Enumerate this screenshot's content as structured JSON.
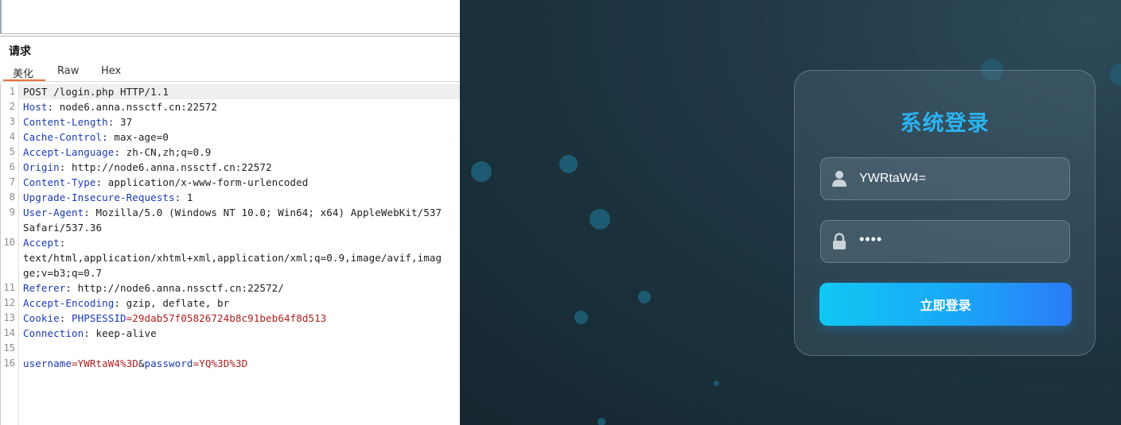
{
  "request_panel": {
    "title": "请求",
    "tabs": [
      {
        "label": "美化",
        "active": true
      },
      {
        "label": "Raw",
        "active": false
      },
      {
        "label": "Hex",
        "active": false
      }
    ],
    "lines": {
      "l1": {
        "n": "1",
        "text": "POST /login.php HTTP/1.1"
      },
      "l2": {
        "n": "2",
        "k": "Host",
        "v": ": node6.anna.nssctf.cn:22572"
      },
      "l3": {
        "n": "3",
        "k": "Content-Length",
        "v": ": 37"
      },
      "l4": {
        "n": "4",
        "k": "Cache-Control",
        "v": ": max-age=0"
      },
      "l5": {
        "n": "5",
        "k": "Accept-Language",
        "v": ": zh-CN,zh;q=0.9"
      },
      "l6": {
        "n": "6",
        "k": "Origin",
        "v": ": http://node6.anna.nssctf.cn:22572"
      },
      "l7": {
        "n": "7",
        "k": "Content-Type",
        "v": ": application/x-www-form-urlencoded"
      },
      "l8": {
        "n": "8",
        "k": "Upgrade-Insecure-Requests",
        "v": ": 1"
      },
      "l9": {
        "n": "9",
        "k": "User-Agent",
        "v": ": Mozilla/5.0 (Windows NT 10.0; Win64; x64) AppleWebKit/537",
        "v2": "Safari/537.36"
      },
      "l10": {
        "n": "10",
        "k": "Accept",
        "v": ":",
        "v2": "text/html,application/xhtml+xml,application/xml;q=0.9,image/avif,imag",
        "v3": "ge;v=b3;q=0.7"
      },
      "l11": {
        "n": "11",
        "k": "Referer",
        "v": ": http://node6.anna.nssctf.cn:22572/"
      },
      "l12": {
        "n": "12",
        "k": "Accept-Encoding",
        "v": ": gzip, deflate, br"
      },
      "l13": {
        "n": "13",
        "k": "Cookie",
        "k2": "PHPSESSID",
        "v": "=29dab57f05826724b8c91beb64f8d513"
      },
      "l14": {
        "n": "14",
        "k": "Connection",
        "v": ": keep-alive"
      },
      "l15": {
        "n": "15"
      },
      "l16": {
        "n": "16",
        "p1k": "username",
        "p1v": "=YWRtaW4%3D",
        "amp": "&",
        "p2k": "password",
        "p2v": "=YQ%3D%3D"
      }
    }
  },
  "login": {
    "title": "系统登录",
    "username_value": "YWRtaW4=",
    "password_mask": "••••",
    "submit_label": "立即登录",
    "user_icon": "user-icon",
    "lock_icon": "lock-icon",
    "title_color": "#2bb3f0",
    "button_gradient": [
      "#11c8f3",
      "#2a7cf7"
    ]
  }
}
